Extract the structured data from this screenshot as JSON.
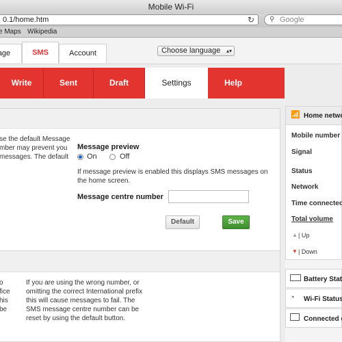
{
  "browser": {
    "window_title": "Mobile Wi-Fi",
    "url": "0.1/home.htm",
    "search_placeholder": "Google",
    "bookmarks": [
      "e Maps",
      "Wikipedia"
    ]
  },
  "top_tabs": [
    "age",
    "SMS",
    "Account"
  ],
  "language_select": {
    "value": "Choose language"
  },
  "sms_tabs": [
    {
      "label": "Write"
    },
    {
      "label": "Sent"
    },
    {
      "label": "Draft"
    },
    {
      "label": "Settings"
    },
    {
      "label": "Help"
    }
  ],
  "settings": {
    "left_help": [
      "se the default Message",
      "mber may prevent you",
      "messages. The default"
    ],
    "preview_title": "Message preview",
    "preview_on": "On",
    "preview_off": "Off",
    "preview_help": [
      "If message preview is enabled this displays SMS messages on",
      "the home screen."
    ],
    "centre_label": "Message centre number",
    "centre_value": "",
    "default_button": "Default",
    "save_button": "Save"
  },
  "lower": {
    "left_frag": [
      "o",
      "fice",
      "his",
      "be"
    ],
    "help": [
      "If you are using the wrong number, or",
      "omitting the correct International prefix",
      "this will cause messages to fail. The",
      "SMS message centre number can be",
      "reset by using the default button."
    ]
  },
  "sidebar": {
    "home_network": "Home netwo",
    "rows": [
      "Mobile number",
      "Signal",
      "Status",
      "Network",
      "Time connected"
    ],
    "total_volume": "Total volume",
    "up": "| Up",
    "down": "| Down",
    "battery": "Battery Statu",
    "wifi": "Wi-Fi Status",
    "connected": "Connected d"
  },
  "colors": {
    "brand_red": "#e3342f",
    "save_green": "#4a9f38",
    "active_blue": "#1f5fc9"
  }
}
